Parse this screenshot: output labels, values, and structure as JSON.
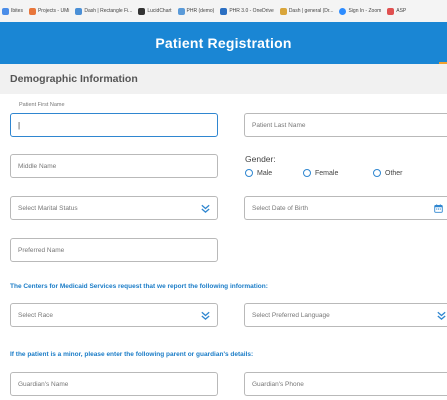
{
  "bookmarks": [
    {
      "label": "Ibites",
      "color": "#4b8de8"
    },
    {
      "label": "Projects - UMi",
      "color": "#e8763b"
    },
    {
      "label": "Dash | Rectangle Fi...",
      "color": "#4a8fd6"
    },
    {
      "label": "LucidChart",
      "color": "#333333"
    },
    {
      "label": "PHR (demo)",
      "color": "#5a9ad8"
    },
    {
      "label": "PHR 3.0 - OneDrive",
      "color": "#2b6fc2"
    },
    {
      "label": "Dash | general (Dr...",
      "color": "#d9a53a"
    },
    {
      "label": "Sign In - Zoom",
      "color": "#2d8cff"
    },
    {
      "label": "ASP",
      "color": "#e05050"
    }
  ],
  "header": {
    "title": "Patient Registration"
  },
  "section": {
    "title": "Demographic Information"
  },
  "fields": {
    "first_name_label": "Patient First Name",
    "first_name_value": "|",
    "last_name": "Patient Last Name",
    "middle_name": "Middle Name",
    "marital_status": "Select Marital Status",
    "dob": "Select Date of Birth",
    "preferred_name": "Preferred Name",
    "race": "Select Race",
    "language": "Select Preferred Language",
    "guardian_name": "Guardian's Name",
    "guardian_phone": "Guardian's Phone"
  },
  "gender": {
    "label": "Gender:",
    "options": [
      "Male",
      "Female",
      "Other"
    ]
  },
  "notices": {
    "cms": "The Centers for Medicaid Services request that we report the following information:",
    "minor": "If the patient is a minor, please enter the following parent or guardian's details:"
  },
  "colors": {
    "brand": "#1a86d4",
    "accent": "#2f86d0"
  }
}
